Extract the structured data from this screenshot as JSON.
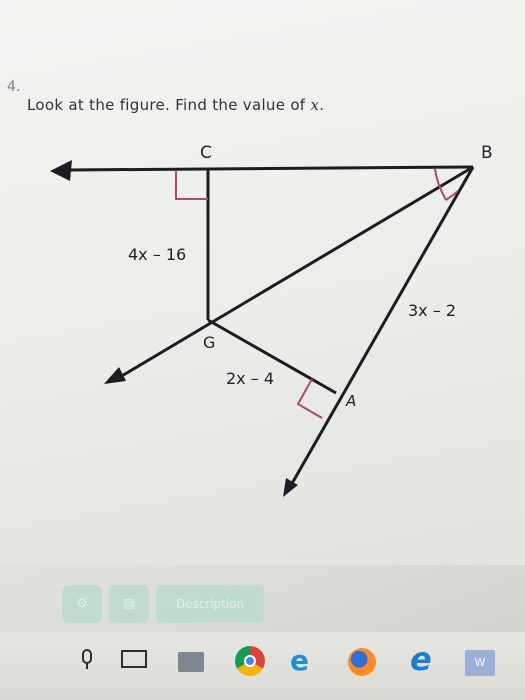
{
  "question": {
    "number": "4.",
    "text_prefix": "Look at the figure. Find the value of ",
    "variable": "x",
    "text_suffix": "."
  },
  "figure": {
    "points": {
      "C": "C",
      "B": "B",
      "G": "G",
      "A": "A"
    },
    "expressions": {
      "CG": "4x – 16",
      "BA": "3x – 2",
      "GA": "2x – 4"
    },
    "stroke_color": "#1c1c22",
    "mark_color": "#b0457a"
  },
  "toolbar": {
    "description_label": "Description"
  },
  "taskbar": {
    "word_label": "W"
  }
}
